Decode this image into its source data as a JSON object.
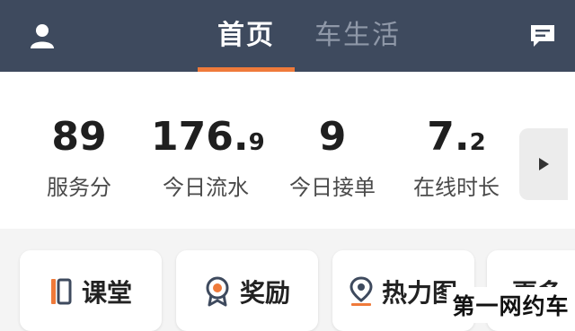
{
  "header": {
    "tabs": [
      {
        "label": "首页",
        "active": true
      },
      {
        "label": "车生活",
        "active": false
      }
    ],
    "left_icon": "user-profile-icon",
    "right_icon": "message-icon",
    "accent_color": "#ef7a3a",
    "background_color": "#3e4a5e"
  },
  "stats": [
    {
      "value_main": "89",
      "value_decimal": "",
      "label": "服务分"
    },
    {
      "value_main": "176.",
      "value_decimal": "9",
      "label": "今日流水"
    },
    {
      "value_main": "9",
      "value_decimal": "",
      "label": "今日接单"
    },
    {
      "value_main": "7.",
      "value_decimal": "2",
      "label": "在线时长"
    }
  ],
  "stats_more_icon": "play-right-icon",
  "shortcuts": [
    {
      "label": "课堂",
      "icon": "book-icon"
    },
    {
      "label": "奖励",
      "icon": "medal-icon"
    },
    {
      "label": "热力图",
      "icon": "location-pin-icon"
    },
    {
      "label": "更多",
      "icon": ""
    }
  ],
  "watermark": "第一网约车"
}
